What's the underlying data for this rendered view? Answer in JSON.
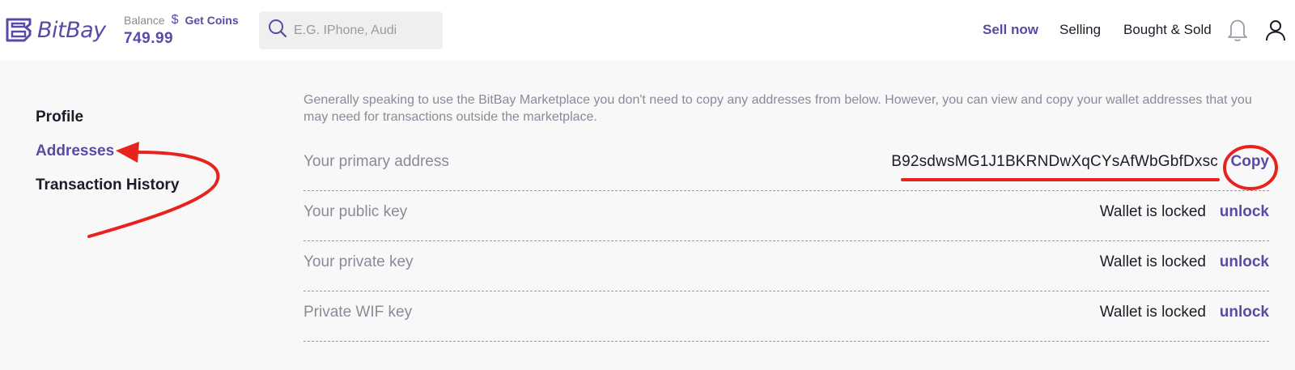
{
  "header": {
    "logo_text": "BitBay",
    "balance_label": "Balance",
    "currency_symbol": "$",
    "get_coins_label": "Get Coins",
    "balance_amount": "749.99",
    "search_placeholder": "E.G. IPhone, Audi",
    "nav": {
      "sell_now": "Sell now",
      "selling": "Selling",
      "bought_sold": "Bought & Sold"
    },
    "icons": [
      "bitbay-logo-icon",
      "search-icon",
      "bell-icon",
      "user-icon"
    ]
  },
  "sidebar": {
    "items": [
      {
        "label": "Profile",
        "active": false
      },
      {
        "label": "Addresses",
        "active": true
      },
      {
        "label": "Transaction History",
        "active": false
      }
    ]
  },
  "main": {
    "intro": "Generally speaking to use the BitBay Marketplace you don't need to copy any addresses from below. However, you can view and copy your wallet addresses that you may need for transactions outside the marketplace.",
    "rows": [
      {
        "label": "Your primary address",
        "value": "B92sdwsMG1J1BKRNDwXqCYsAfWbGbfDxsc",
        "action": "Copy"
      },
      {
        "label": "Your public key",
        "value": "Wallet is locked",
        "action": "unlock"
      },
      {
        "label": "Your private key",
        "value": "Wallet is locked",
        "action": "unlock"
      },
      {
        "label": "Private WIF key",
        "value": "Wallet is locked",
        "action": "unlock"
      }
    ]
  },
  "colors": {
    "accent": "#5a4aa6",
    "annotation": "#e8231e",
    "text": "#1c1c28",
    "muted": "#8a8a9a"
  }
}
